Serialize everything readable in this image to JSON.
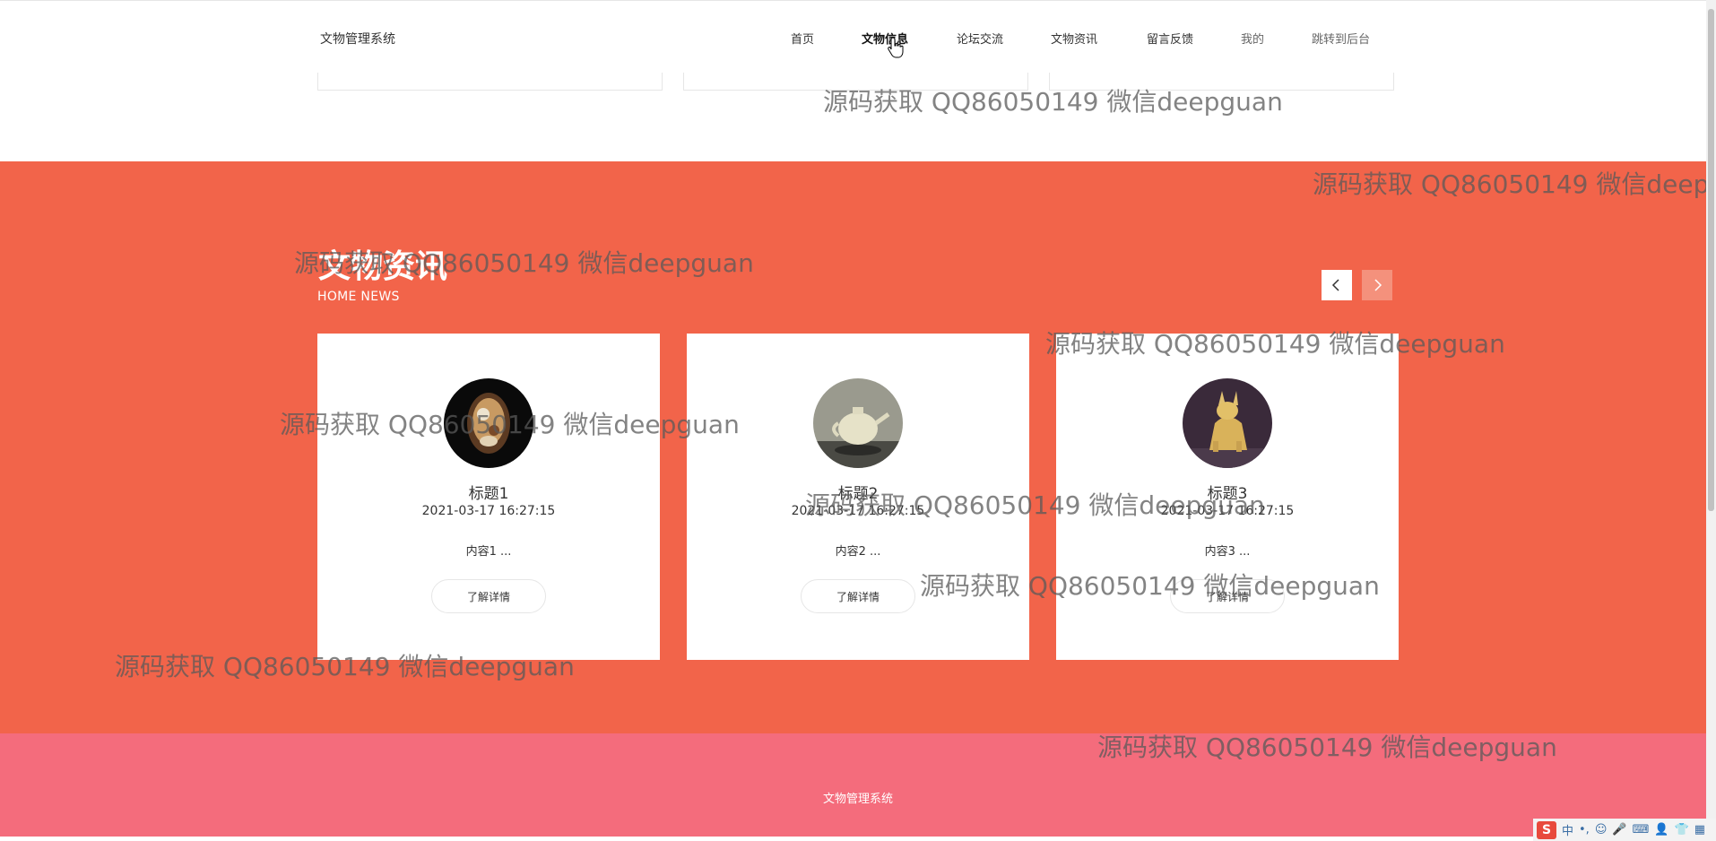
{
  "header": {
    "brand": "文物管理系统",
    "nav": [
      "首页",
      "文物信息",
      "论坛交流",
      "文物资讯",
      "留言反馈",
      "我的",
      "跳转到后台"
    ]
  },
  "news": {
    "title": "文物资讯",
    "subtitle": "HOME NEWS",
    "prev_icon": "chevron-left-icon",
    "next_icon": "chevron-right-icon",
    "cards": [
      {
        "title": "标题1",
        "date": "2021-03-17 16:27:15",
        "content": "内容1 ...",
        "button": "了解详情"
      },
      {
        "title": "标题2",
        "date": "2021-03-17 16:27:15",
        "content": "内容2 ...",
        "button": "了解详情"
      },
      {
        "title": "标题3",
        "date": "2021-03-17 16:27:15",
        "content": "内容3 ...",
        "button": "了解详情"
      }
    ]
  },
  "footer": {
    "text": "文物管理系统"
  },
  "watermark": "源码获取 QQ86050149 微信deepguan",
  "ime": {
    "logo": "S",
    "mode": "中"
  },
  "colors": {
    "news_bg": "#f2644a",
    "footer_bg": "#f46c7c",
    "next_btn": "#f4917c"
  }
}
